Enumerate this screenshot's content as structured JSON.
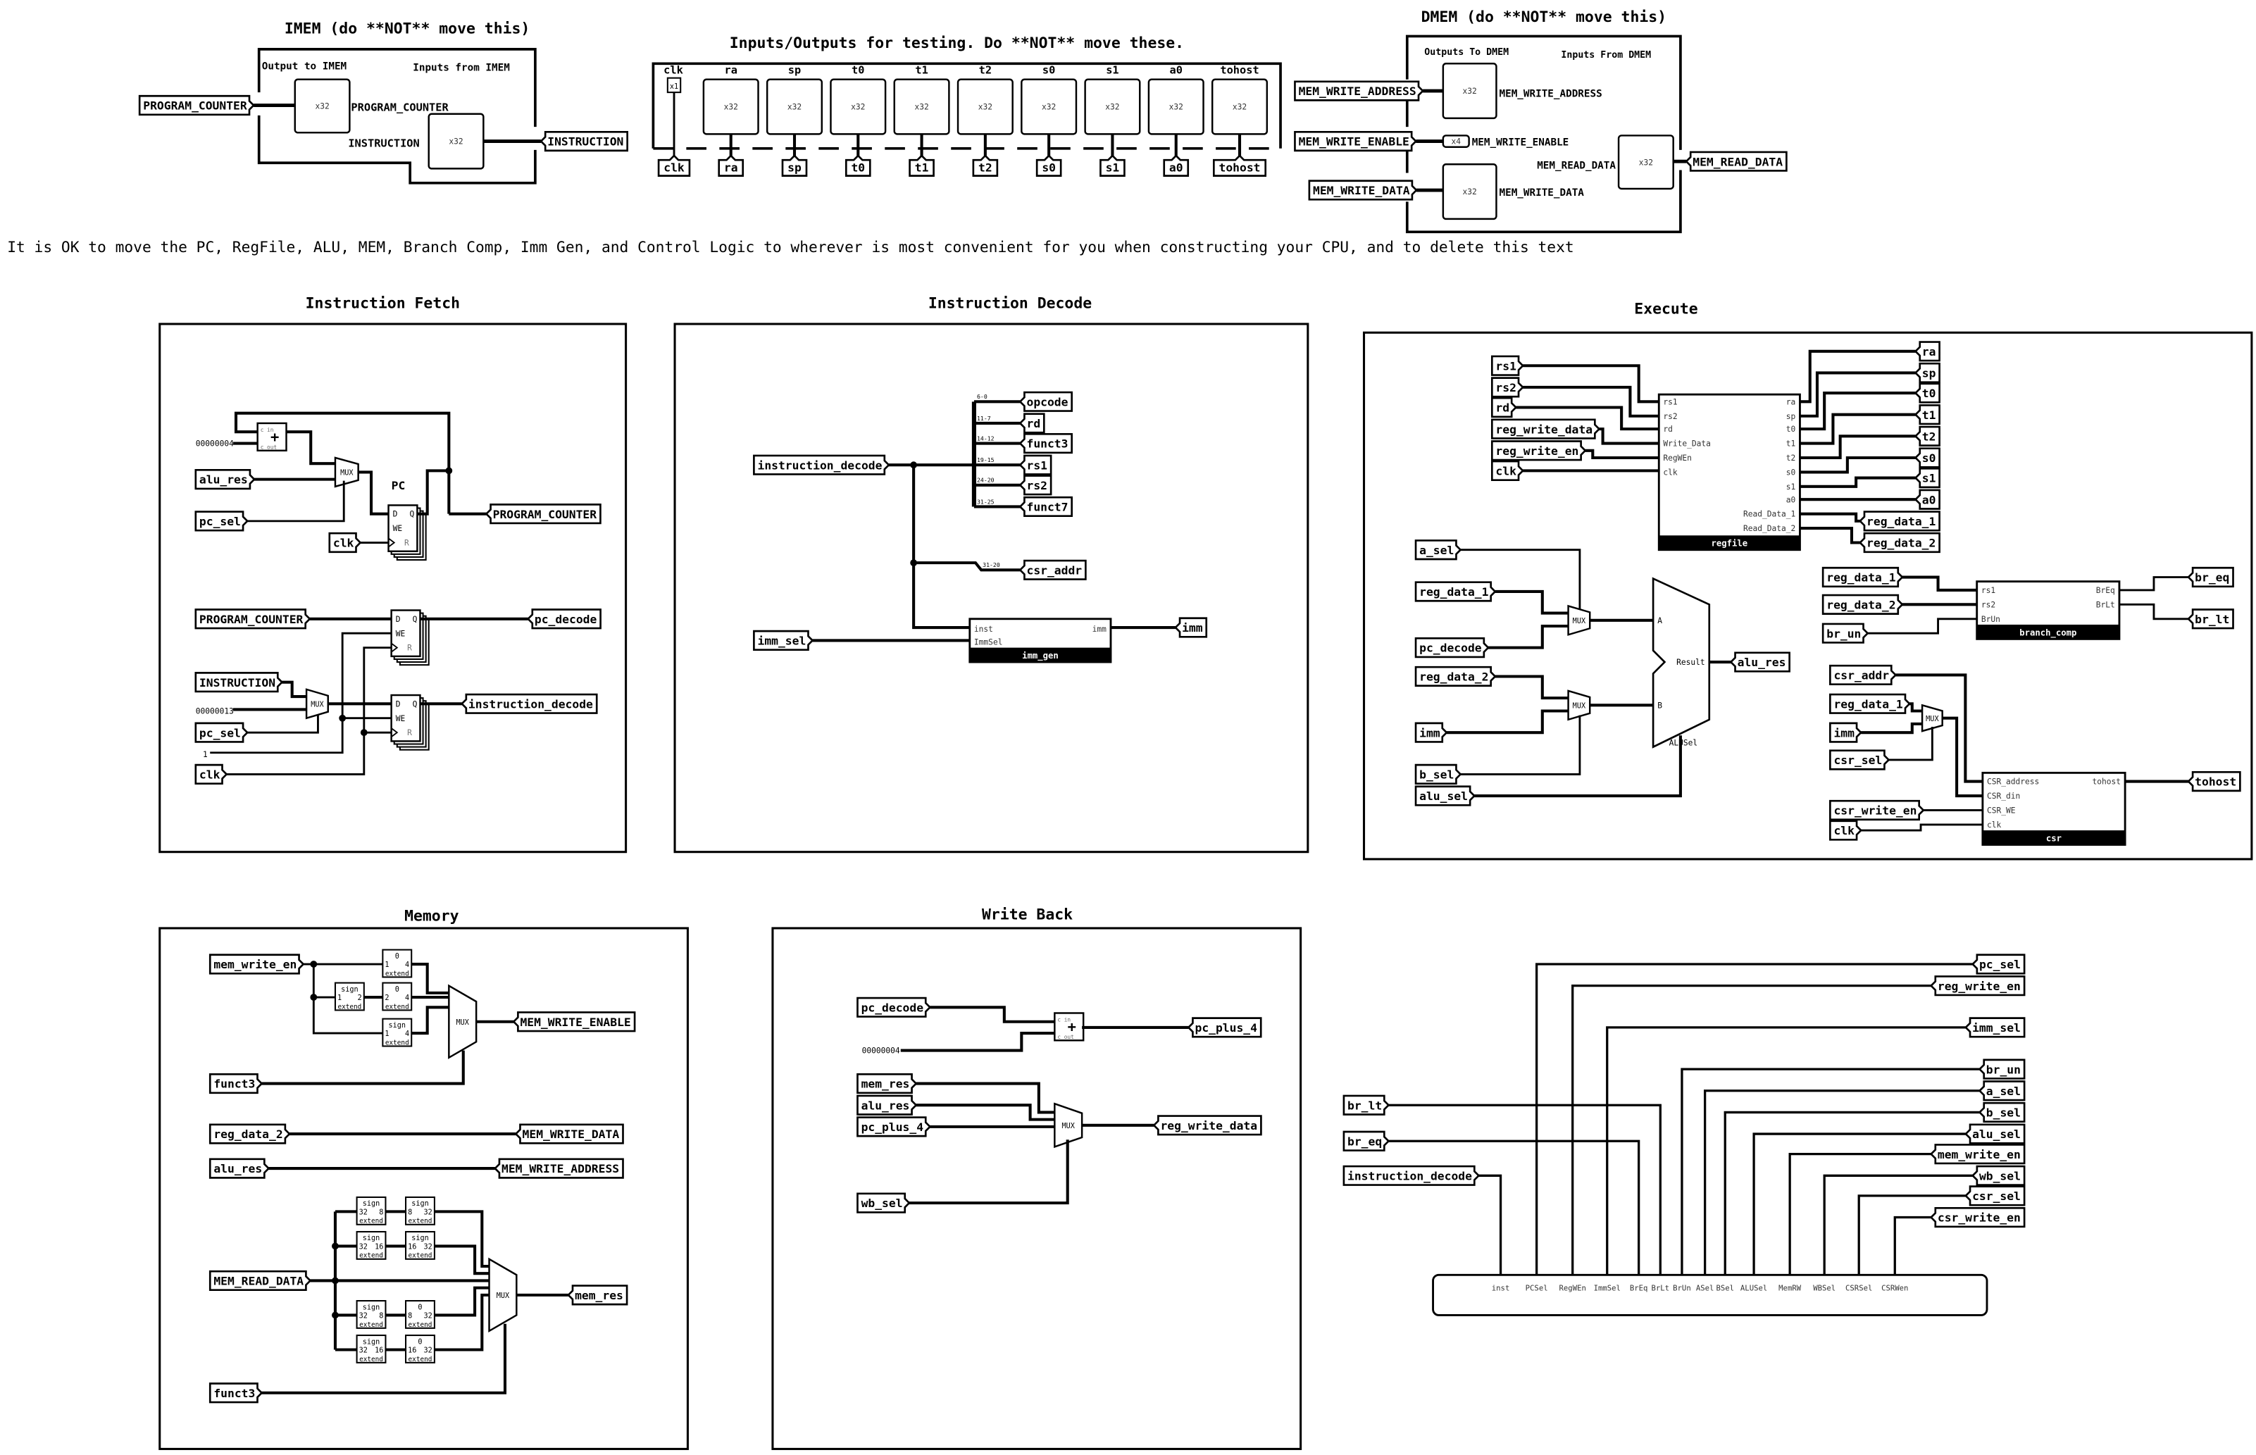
{
  "common": {
    "mux": "MUX",
    "reg_pins": [
      "D",
      "Q",
      "WE",
      "R"
    ],
    "adder_pins": [
      "c in",
      "c out"
    ],
    "adder_symbol": "+",
    "extend": "extend"
  },
  "imem": {
    "title": "IMEM (do **NOT** move this)",
    "outputs_label": "Output to IMEM",
    "inputs_label": "Inputs from IMEM",
    "pc_tunnel": "PROGRAM_COUNTER",
    "pc_pin_label": "PROGRAM_COUNTER",
    "pc_width": "x32",
    "instr_pin_label": "INSTRUCTION",
    "instr_width": "x32",
    "instr_tunnel": "INSTRUCTION"
  },
  "testing": {
    "title": "Inputs/Outputs for testing. Do **NOT** move these.",
    "pins": [
      {
        "label": "clk",
        "width": "x1",
        "tunnel": "clk"
      },
      {
        "label": "ra",
        "width": "x32",
        "tunnel": "ra"
      },
      {
        "label": "sp",
        "width": "x32",
        "tunnel": "sp"
      },
      {
        "label": "t0",
        "width": "x32",
        "tunnel": "t0"
      },
      {
        "label": "t1",
        "width": "x32",
        "tunnel": "t1"
      },
      {
        "label": "t2",
        "width": "x32",
        "tunnel": "t2"
      },
      {
        "label": "s0",
        "width": "x32",
        "tunnel": "s0"
      },
      {
        "label": "s1",
        "width": "x32",
        "tunnel": "s1"
      },
      {
        "label": "a0",
        "width": "x32",
        "tunnel": "a0"
      },
      {
        "label": "tohost",
        "width": "x32",
        "tunnel": "tohost"
      }
    ]
  },
  "dmem": {
    "title": "DMEM (do **NOT** move this)",
    "outputs_label": "Outputs To DMEM",
    "inputs_label": "Inputs From DMEM",
    "addr_tunnel": "MEM_WRITE_ADDRESS",
    "addr_label": "MEM_WRITE_ADDRESS",
    "addr_width": "x32",
    "en_tunnel": "MEM_WRITE_ENABLE",
    "en_label": "MEM_WRITE_ENABLE",
    "en_width": "x4",
    "data_tunnel": "MEM_WRITE_DATA",
    "data_label": "MEM_WRITE_DATA",
    "data_width": "x32",
    "read_label": "MEM_READ_DATA",
    "read_width": "x32",
    "read_tunnel": "MEM_READ_DATA"
  },
  "note": "It is OK to move the PC, RegFile, ALU, MEM, Branch Comp, Imm Gen, and Control Logic to wherever is most convenient for you when constructing your CPU, and to delete this text",
  "fetch": {
    "title": "Instruction Fetch",
    "pc_label": "PC",
    "constants": [
      "00000004",
      "00000013",
      "1"
    ],
    "tunnels": [
      "alu_res",
      "pc_sel",
      "clk",
      "PROGRAM_COUNTER",
      "PROGRAM_COUNTER",
      "pc_decode",
      "INSTRUCTION",
      "pc_sel",
      "clk",
      "instruction_decode"
    ]
  },
  "decode": {
    "title": "Instruction Decode",
    "tunnels": [
      "instruction_decode",
      "opcode",
      "rd",
      "funct3",
      "rs1",
      "rs2",
      "funct7",
      "csr_addr",
      "imm_sel",
      "imm"
    ],
    "bit_ranges": [
      "6-0",
      "11-7",
      "14-12",
      "19-15",
      "24-20",
      "31-25",
      "31-20"
    ],
    "imm_gen": {
      "name": "imm_gen",
      "inputs": [
        "inst",
        "ImmSel"
      ],
      "outputs": [
        "imm"
      ]
    }
  },
  "execute": {
    "title": "Execute",
    "regfile": {
      "name": "regfile",
      "inputs": [
        "rs1",
        "rs2",
        "rd",
        "Write_Data",
        "RegWEn",
        "clk"
      ],
      "outputs": [
        "ra",
        "sp",
        "t0",
        "t1",
        "t2",
        "s0",
        "s1",
        "a0",
        "Read_Data_1",
        "Read_Data_2"
      ]
    },
    "regfile_in": [
      "rs1",
      "rs2",
      "rd",
      "reg_write_data",
      "reg_write_en",
      "clk"
    ],
    "regfile_out": [
      "ra",
      "sp",
      "t0",
      "t1",
      "t2",
      "s0",
      "s1",
      "a0",
      "reg_data_1",
      "reg_data_2"
    ],
    "alu": {
      "inputs": [
        "A",
        "B"
      ],
      "output": "Result",
      "select": "ALUSel"
    },
    "alu_tunnels": [
      "a_sel",
      "reg_data_1",
      "pc_decode",
      "reg_data_2",
      "imm",
      "b_sel",
      "alu_sel",
      "alu_res"
    ],
    "branch_comp": {
      "name": "branch_comp",
      "inputs": [
        "rs1",
        "rs2",
        "BrUn"
      ],
      "outputs": [
        "BrEq",
        "BrLt"
      ]
    },
    "branch_tunnels": [
      "reg_data_1",
      "reg_data_2",
      "br_un",
      "br_eq",
      "br_lt"
    ],
    "csr": {
      "name": "csr",
      "inputs": [
        "CSR_address",
        "CSR_din",
        "CSR_WE",
        "clk"
      ],
      "outputs": [
        "tohost"
      ]
    },
    "csr_tunnels": [
      "csr_addr",
      "reg_data_1",
      "imm",
      "csr_sel",
      "csr_write_en",
      "clk",
      "tohost"
    ]
  },
  "memory": {
    "title": "Memory",
    "tunnels": [
      "mem_write_en",
      "funct3",
      "MEM_WRITE_ENABLE",
      "reg_data_2",
      "MEM_WRITE_DATA",
      "alu_res",
      "MEM_WRITE_ADDRESS",
      "MEM_READ_DATA",
      "mem_res",
      "funct3"
    ],
    "ext_top": [
      {
        "type": "0",
        "in": "1",
        "out": "4"
      },
      {
        "type": "sign",
        "in": "1",
        "out": "2"
      },
      {
        "type": "0",
        "in": "2",
        "out": "4"
      },
      {
        "type": "sign",
        "in": "1",
        "out": "4"
      }
    ],
    "ext_bottom": [
      {
        "type": "sign",
        "in": "32",
        "out": "8"
      },
      {
        "type": "sign",
        "in": "8",
        "out": "32"
      },
      {
        "type": "sign",
        "in": "32",
        "out": "16"
      },
      {
        "type": "sign",
        "in": "16",
        "out": "32"
      },
      {
        "type": "sign",
        "in": "32",
        "out": "8"
      },
      {
        "type": "0",
        "in": "8",
        "out": "32"
      },
      {
        "type": "sign",
        "in": "32",
        "out": "16"
      },
      {
        "type": "0",
        "in": "16",
        "out": "32"
      }
    ]
  },
  "writeback": {
    "title": "Write Back",
    "constant": "00000004",
    "tunnels": [
      "pc_decode",
      "pc_plus_4",
      "mem_res",
      "alu_res",
      "pc_plus_4",
      "reg_write_data",
      "wb_sel"
    ]
  },
  "control": {
    "pins": [
      "inst",
      "PCSel",
      "RegWEn",
      "ImmSel",
      "BrEq",
      "BrLt",
      "BrUn",
      "ASel",
      "BSel",
      "ALUSel",
      "MemRW",
      "WBSel",
      "CSRSel",
      "CSRWen"
    ],
    "outputs": [
      "pc_sel",
      "reg_write_en",
      "imm_sel",
      "br_un",
      "a_sel",
      "b_sel",
      "alu_sel",
      "mem_write_en",
      "wb_sel",
      "csr_sel",
      "csr_write_en"
    ],
    "inputs": [
      "br_lt",
      "br_eq",
      "instruction_decode"
    ]
  }
}
